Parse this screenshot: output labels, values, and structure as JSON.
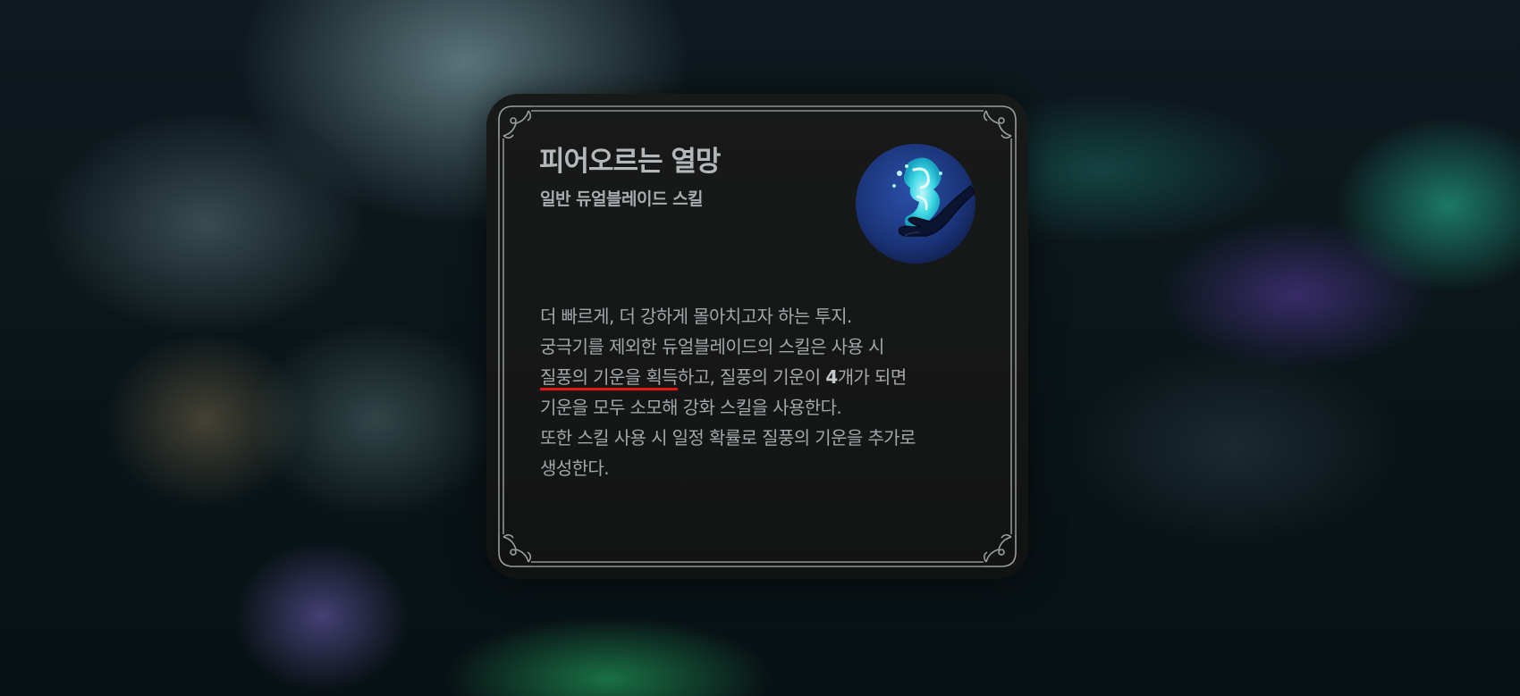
{
  "skill": {
    "title": "피어오르는 열망",
    "subtitle": "일반 듀얼블레이드 스킬",
    "icon": "wind-energy-hand-icon",
    "description": {
      "line1": "더 빠르게, 더 강하게 몰아치고자 하는 투지.",
      "line2": "궁극기를 제외한 듀얼블레이드의 스킬은 사용 시",
      "line3_highlight": "질풍의 기운을 획득",
      "line3_a": "하고, 질풍의 기운이 ",
      "line3_number": "4",
      "line3_b": "개가 되면",
      "line4": "기운을 모두 소모해 강화 스킬을 사용한다.",
      "line5": "또한 스킬 사용 시 일정 확률로 질풍의 기운을 추가로",
      "line6": "생성한다."
    }
  },
  "colors": {
    "highlight_underline": "#e01818",
    "card_background": "#161717",
    "frame": "#8e9295",
    "icon_accent": "#3ee0e8"
  }
}
